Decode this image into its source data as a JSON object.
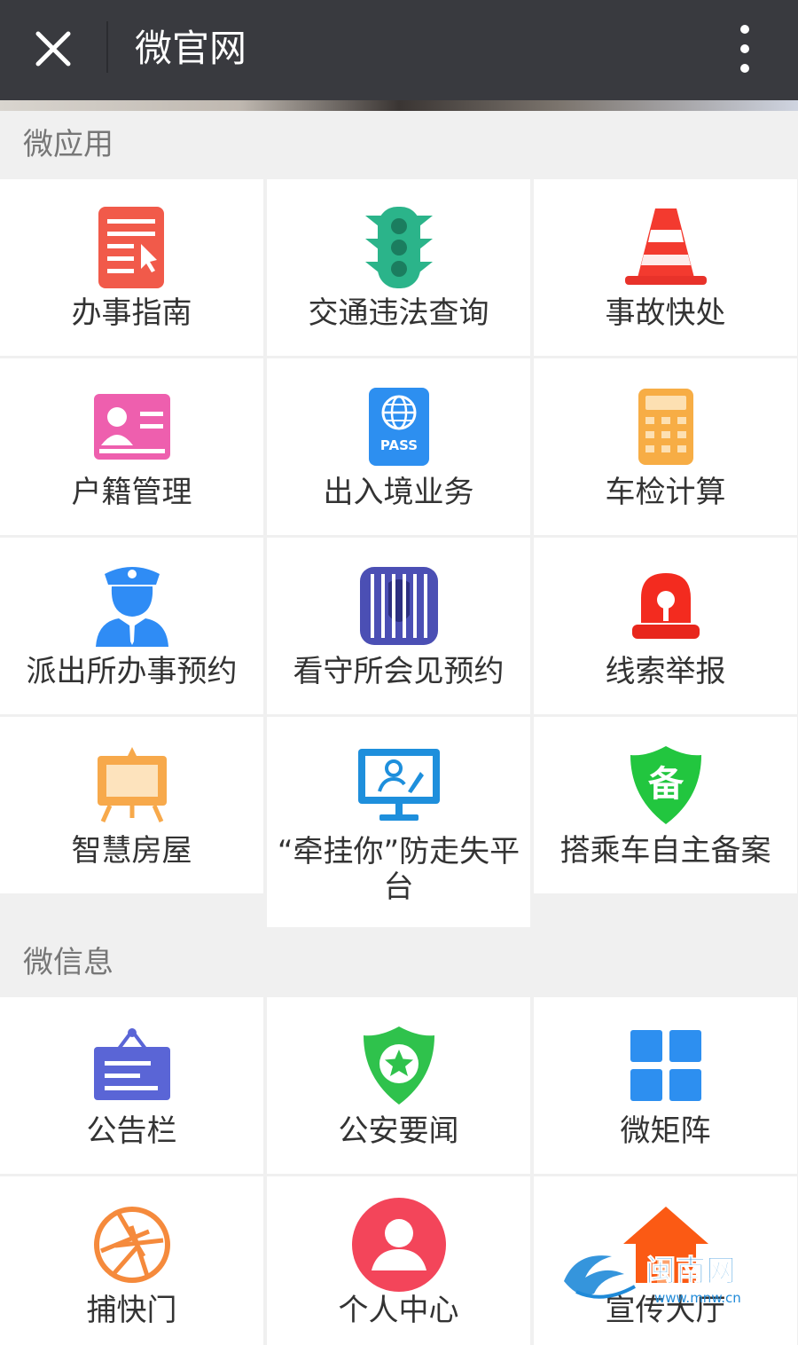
{
  "header": {
    "title": "微官网",
    "close_icon": "close-icon",
    "more_icon": "more-vertical-icon"
  },
  "sections": [
    {
      "title": "微应用"
    },
    {
      "title": "微信息"
    }
  ],
  "apps": [
    {
      "label": "办事指南",
      "icon": "document-guide-icon"
    },
    {
      "label": "交通违法查询",
      "icon": "traffic-light-icon"
    },
    {
      "label": "事故快处",
      "icon": "traffic-cone-icon"
    },
    {
      "label": "户籍管理",
      "icon": "id-card-icon"
    },
    {
      "label": "出入境业务",
      "icon": "passport-icon"
    },
    {
      "label": "车检计算",
      "icon": "calculator-icon"
    },
    {
      "label": "派出所办事预约",
      "icon": "police-officer-icon"
    },
    {
      "label": "看守所会见预约",
      "icon": "prison-bars-icon"
    },
    {
      "label": "线索举报",
      "icon": "alarm-siren-icon"
    },
    {
      "label": "智慧房屋",
      "icon": "easel-board-icon"
    },
    {
      "label": "“牵挂你”防走失平台",
      "icon": "monitor-person-icon"
    },
    {
      "label": "搭乘车自主备案",
      "icon": "shield-record-icon",
      "badge": "备"
    }
  ],
  "info": [
    {
      "label": "公告栏",
      "icon": "notice-board-icon"
    },
    {
      "label": "公安要闻",
      "icon": "police-badge-icon"
    },
    {
      "label": "微矩阵",
      "icon": "grid-matrix-icon"
    },
    {
      "label": "捕快门",
      "icon": "camera-shutter-icon"
    },
    {
      "label": "个人中心",
      "icon": "user-profile-icon"
    },
    {
      "label": "宣传大厅",
      "icon": "home-hall-icon"
    }
  ],
  "watermark": {
    "name": "闽南网",
    "url": "www.mnw.cn"
  },
  "colors": {
    "topbar": "#393a3f",
    "background": "#f0f0f0",
    "cell": "#ffffff",
    "text": "#333333"
  }
}
